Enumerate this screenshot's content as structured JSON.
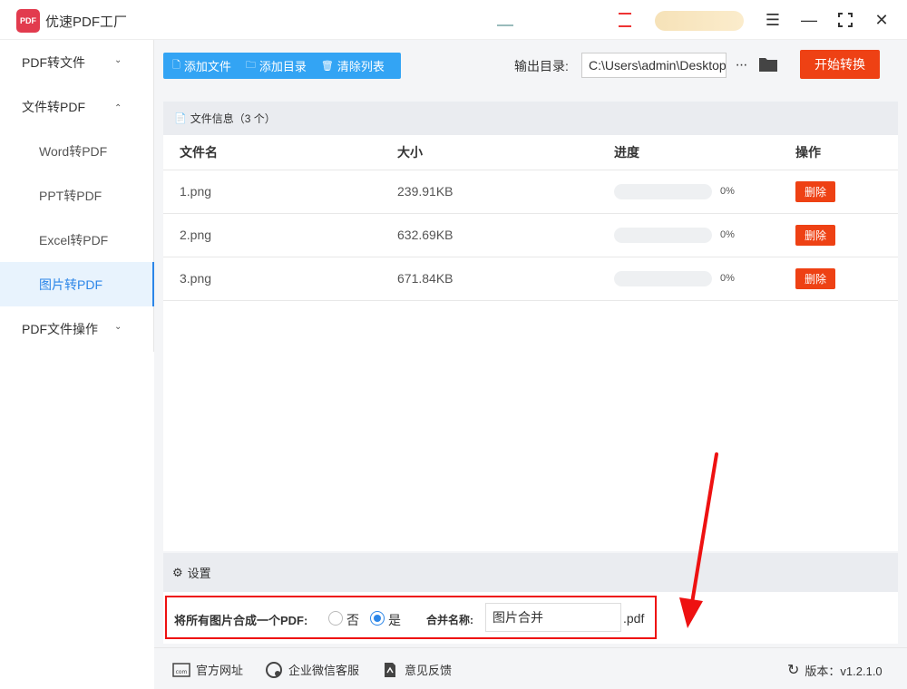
{
  "app": {
    "title": "优速PDF工厂",
    "logo_text": "PDF"
  },
  "sidebar": {
    "groups": [
      {
        "label": "PDF转文件"
      },
      {
        "label": "文件转PDF"
      },
      {
        "label": "PDF文件操作"
      }
    ],
    "items": [
      {
        "label": "Word转PDF"
      },
      {
        "label": "PPT转PDF"
      },
      {
        "label": "Excel转PDF"
      },
      {
        "label": "图片转PDF"
      }
    ]
  },
  "toolbar": {
    "add_file": "添加文件",
    "add_dir": "添加目录",
    "clear_list": "清除列表",
    "output_label": "输出目录:",
    "output_path": "C:\\Users\\admin\\Desktop",
    "start": "开始转换"
  },
  "files": {
    "header": "文件信息（3 个）",
    "columns": [
      "文件名",
      "大小",
      "进度",
      "操作"
    ],
    "rows": [
      {
        "name": "1.png",
        "size": "239.91KB",
        "progress": "0%",
        "progress_value": 0,
        "action": "删除"
      },
      {
        "name": "2.png",
        "size": "632.69KB",
        "progress": "0%",
        "progress_value": 0,
        "action": "删除"
      },
      {
        "name": "3.png",
        "size": "671.84KB",
        "progress": "0%",
        "progress_value": 0,
        "action": "删除"
      }
    ]
  },
  "settings": {
    "title": "设置",
    "merge_label": "将所有图片合成一个PDF:",
    "option_no": "否",
    "option_yes": "是",
    "selected": "是",
    "name_label": "合并名称:",
    "name_value": "图片合并",
    "ext": ".pdf"
  },
  "footer": {
    "website": "官方网址",
    "wechat": "企业微信客服",
    "feedback": "意见反馈",
    "version": "版本：v1.2.1.0"
  },
  "colors": {
    "accent": "#33a4f4",
    "danger": "#ee4114",
    "highlight": "#e11111"
  }
}
